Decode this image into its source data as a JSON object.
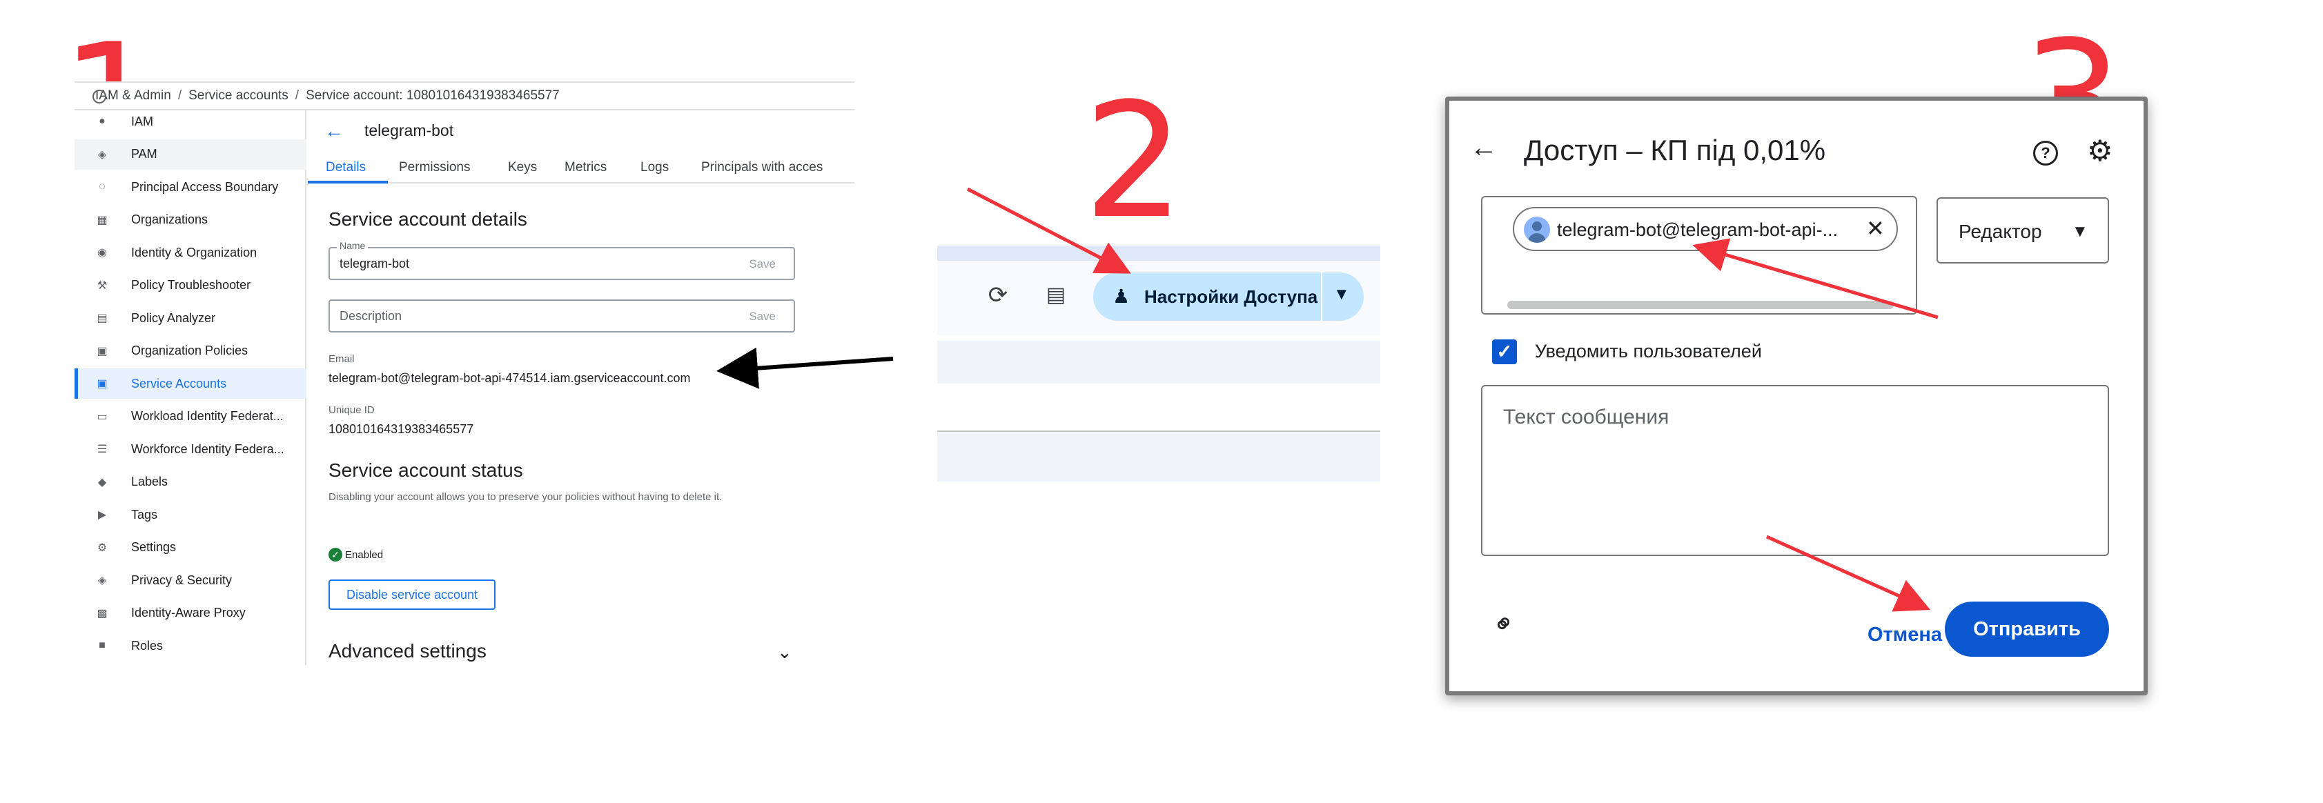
{
  "steps": {
    "one": "1",
    "two": "2",
    "three": "3"
  },
  "panel1": {
    "breadcrumb": [
      "IAM & Admin",
      "Service accounts",
      "Service account: 108010164319383465577"
    ],
    "sidebar": [
      {
        "icon": "person-shield-icon",
        "glyph": "●",
        "label": "IAM"
      },
      {
        "icon": "shield-icon",
        "glyph": "◈",
        "label": "PAM"
      },
      {
        "icon": "boundary-icon",
        "glyph": "◌",
        "label": "Principal Access Boundary"
      },
      {
        "icon": "organizations-icon",
        "glyph": "▦",
        "label": "Organizations"
      },
      {
        "icon": "account-circle-icon",
        "glyph": "◉",
        "label": "Identity & Organization"
      },
      {
        "icon": "wrench-icon",
        "glyph": "⚒",
        "label": "Policy Troubleshooter"
      },
      {
        "icon": "policy-analyzer-icon",
        "glyph": "▤",
        "label": "Policy Analyzer"
      },
      {
        "icon": "policy-list-icon",
        "glyph": "▣",
        "label": "Organization Policies"
      },
      {
        "icon": "service-account-icon",
        "glyph": "▣",
        "label": "Service Accounts"
      },
      {
        "icon": "badge-icon",
        "glyph": "▭",
        "label": "Workload Identity Federat..."
      },
      {
        "icon": "list-icon",
        "glyph": "☰",
        "label": "Workforce Identity Federa..."
      },
      {
        "icon": "label-icon",
        "glyph": "◆",
        "label": "Labels"
      },
      {
        "icon": "tag-icon",
        "glyph": "▶",
        "label": "Tags"
      },
      {
        "icon": "gear-icon",
        "glyph": "⚙",
        "label": "Settings"
      },
      {
        "icon": "security-shield-icon",
        "glyph": "◈",
        "label": "Privacy & Security"
      },
      {
        "icon": "proxy-icon",
        "glyph": "▩",
        "label": "Identity-Aware Proxy"
      },
      {
        "icon": "roles-icon",
        "glyph": "■",
        "label": "Roles"
      }
    ],
    "active_item": "Service Accounts",
    "title": "telegram-bot",
    "tabs": [
      "Details",
      "Permissions",
      "Keys",
      "Metrics",
      "Logs",
      "Principals with acces"
    ],
    "details_heading": "Service account details",
    "name_label": "Name",
    "name_value": "telegram-bot",
    "save_label": "Save",
    "description_placeholder": "Description",
    "email_label": "Email",
    "email_value": "telegram-bot@telegram-bot-api-474514.iam.gserviceaccount.com",
    "unique_id_label": "Unique ID",
    "unique_id_value": "108010164319383465577",
    "status_heading": "Service account status",
    "status_note": "Disabling your account allows you to preserve your policies without having to delete it.",
    "status_value": "Enabled",
    "disable_button": "Disable service account",
    "advanced_heading": "Advanced settings"
  },
  "panel2": {
    "share_button": "Настройки Доступа"
  },
  "panel3": {
    "title": "Доступ – КП під 0,01%",
    "chip_text": "telegram-bot@telegram-bot-api-...",
    "role": "Редактор",
    "notify_label": "Уведомить пользователей",
    "notify_checked": true,
    "message_placeholder": "Текст сообщения",
    "cancel_button": "Отмена",
    "send_button": "Отправить"
  },
  "colors": {
    "annotation_red": "#f0333a",
    "accent_blue": "#1a73e8",
    "docs_blue": "#0b57d0",
    "share_button_bg": "#c2e7ff"
  }
}
